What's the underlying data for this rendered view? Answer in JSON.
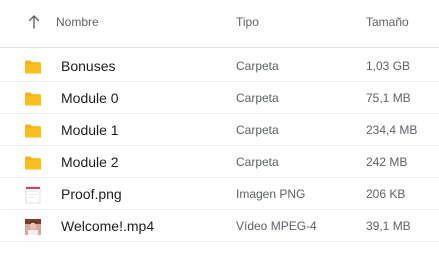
{
  "columns": {
    "name": "Nombre",
    "type": "Tipo",
    "size": "Tamaño",
    "sort_icon": "arrow-up-icon"
  },
  "colors": {
    "folder": "#f9b417",
    "folder_dark": "#e6a10c"
  },
  "files": [
    {
      "name": "Bonuses",
      "type": "Carpeta",
      "size": "1,03 GB",
      "icon": "folder-icon"
    },
    {
      "name": "Module 0",
      "type": "Carpeta",
      "size": "75,1 MB",
      "icon": "folder-icon"
    },
    {
      "name": "Module 1",
      "type": "Carpeta",
      "size": "234,4 MB",
      "icon": "folder-icon"
    },
    {
      "name": "Module 2",
      "type": "Carpeta",
      "size": "242 MB",
      "icon": "folder-icon"
    },
    {
      "name": "Proof.png",
      "type": "Imagen PNG",
      "size": "206 KB",
      "icon": "image-file-icon"
    },
    {
      "name": "Welcome!.mp4",
      "type": "Vídeo MPEG-4",
      "size": "39,1 MB",
      "icon": "video-thumbnail-icon"
    }
  ]
}
